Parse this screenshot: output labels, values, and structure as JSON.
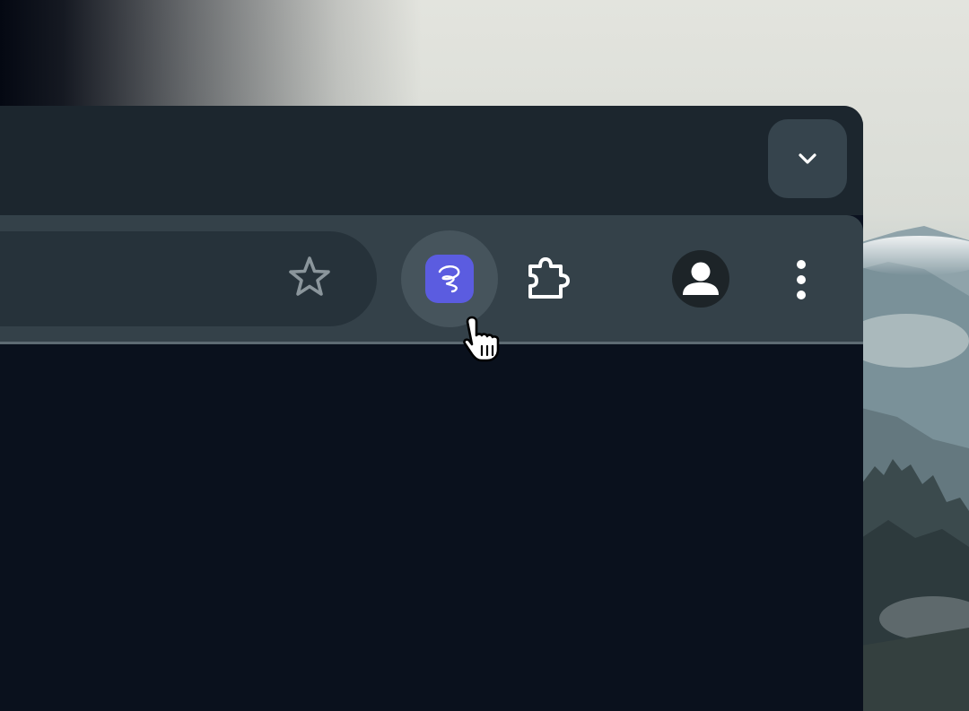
{
  "window": {
    "title": ""
  },
  "icons": {
    "tab_search": "chevron-down-icon",
    "bookmark": "star-icon",
    "extension": "scribble-extension-icon",
    "extensions_menu": "puzzle-piece-icon",
    "profile": "person-icon",
    "menu": "kebab-menu-icon",
    "cursor": "hand-pointer-icon"
  },
  "colors": {
    "tab_strip": "#1c262e",
    "toolbar": "#344149",
    "omnibox": "#26323a",
    "extension_accent": "#5b5ce0",
    "page_background": "#0a111d"
  }
}
